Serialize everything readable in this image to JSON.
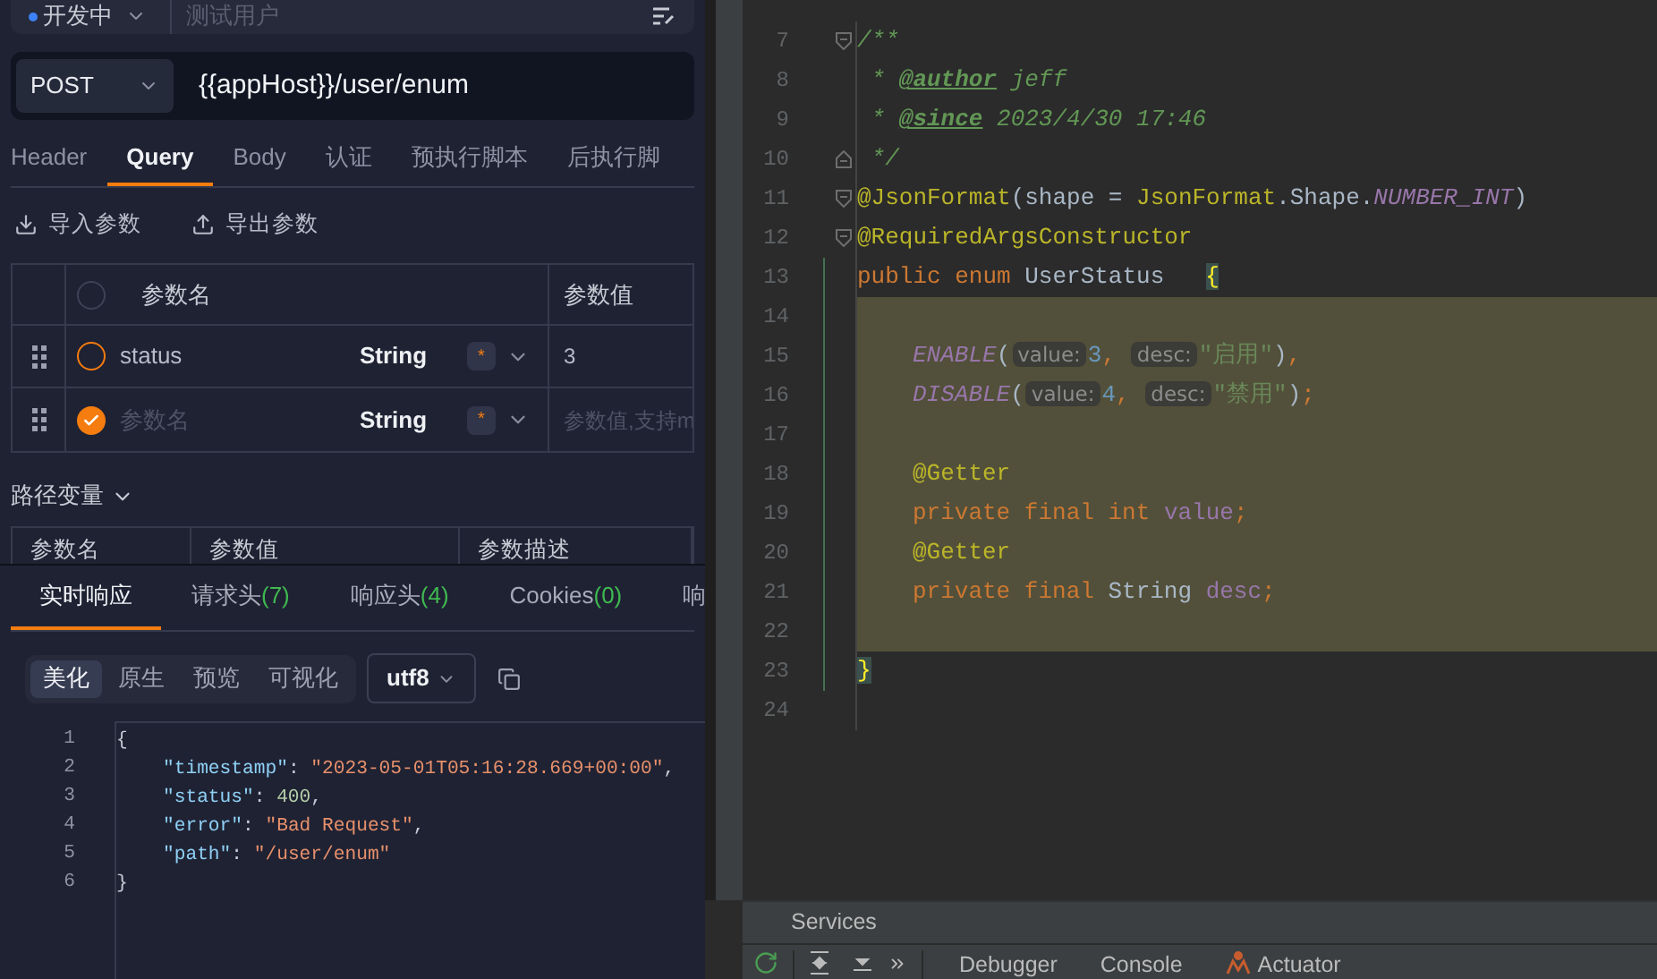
{
  "env_bar": {
    "environment": "开发中",
    "user_placeholder": "测试用户"
  },
  "request": {
    "method": "POST",
    "url": "{{appHost}}/user/enum"
  },
  "request_tabs": [
    {
      "label": "Header",
      "selected": false
    },
    {
      "label": "Query",
      "selected": true
    },
    {
      "label": "Body",
      "selected": false
    },
    {
      "label": "认证",
      "selected": false
    },
    {
      "label": "预执行脚本",
      "selected": false
    },
    {
      "label": "后执行脚",
      "selected": false
    }
  ],
  "param_actions": [
    {
      "kind": "import",
      "label": "导入参数"
    },
    {
      "kind": "export",
      "label": "导出参数"
    }
  ],
  "query_table": {
    "all_checked": false,
    "columns": [
      "参数名",
      "参数值"
    ],
    "rows": [
      {
        "name": "status",
        "type": "String",
        "required_mark": "*",
        "value": "3",
        "checked": false
      },
      {
        "name_placeholder": "参数名",
        "type": "String",
        "required_mark": "*",
        "value_placeholder": "参数值,支持m",
        "checked": true
      }
    ]
  },
  "path_variables": {
    "label": "路径变量",
    "expanded": true,
    "columns": [
      "参数名",
      "参数值",
      "参数描述"
    ]
  },
  "response": {
    "tabs": [
      {
        "label": "实时响应",
        "selected": true
      },
      {
        "label": "请求头",
        "count": "(7)",
        "selected": false
      },
      {
        "label": "响应头",
        "count": "(4)",
        "selected": false
      },
      {
        "label": "Cookies",
        "count": "(0)",
        "selected": false
      },
      {
        "label": "响",
        "selected": false
      }
    ],
    "view_modes": [
      {
        "label": "美化",
        "selected": true
      },
      {
        "label": "原生",
        "selected": false
      },
      {
        "label": "预览",
        "selected": false
      },
      {
        "label": "可视化",
        "selected": false
      }
    ],
    "encoding": "utf8",
    "body_lines": [
      {
        "number": "1",
        "indented": false,
        "tokens": [
          {
            "t": "{",
            "kind": "punct"
          }
        ]
      },
      {
        "number": "2",
        "indented": true,
        "tokens": [
          {
            "t": "\"timestamp\"",
            "kind": "key"
          },
          {
            "t": ": ",
            "kind": "punct"
          },
          {
            "t": "\"2023-05-01T05:16:28.669+00:00\"",
            "kind": "string"
          },
          {
            "t": ",",
            "kind": "punct"
          }
        ]
      },
      {
        "number": "3",
        "indented": true,
        "tokens": [
          {
            "t": "\"status\"",
            "kind": "key"
          },
          {
            "t": ": ",
            "kind": "punct"
          },
          {
            "t": "400",
            "kind": "number"
          },
          {
            "t": ",",
            "kind": "punct"
          }
        ]
      },
      {
        "number": "4",
        "indented": true,
        "tokens": [
          {
            "t": "\"error\"",
            "kind": "key"
          },
          {
            "t": ": ",
            "kind": "punct"
          },
          {
            "t": "\"Bad Request\"",
            "kind": "string"
          },
          {
            "t": ",",
            "kind": "punct"
          }
        ]
      },
      {
        "number": "5",
        "indented": true,
        "tokens": [
          {
            "t": "\"path\"",
            "kind": "key"
          },
          {
            "t": ": ",
            "kind": "punct"
          },
          {
            "t": "\"/user/enum\"",
            "kind": "string"
          }
        ]
      },
      {
        "number": "6",
        "indented": false,
        "tokens": [
          {
            "t": "}",
            "kind": "punct"
          }
        ]
      }
    ]
  },
  "editor": {
    "lines": [
      {
        "number": "7",
        "kind": "fold_open",
        "highlighted": false,
        "indented": false,
        "changed": false,
        "tokens": [
          {
            "t": "/**",
            "kind": "comment"
          }
        ]
      },
      {
        "number": "8",
        "kind": "code",
        "highlighted": false,
        "indented": false,
        "changed": false,
        "tokens": [
          {
            "t": " * ",
            "kind": "comment"
          },
          {
            "t": "@author",
            "kind": "doctag"
          },
          {
            "t": " jeff",
            "kind": "comment"
          }
        ]
      },
      {
        "number": "9",
        "kind": "code",
        "highlighted": false,
        "indented": false,
        "changed": false,
        "tokens": [
          {
            "t": " * ",
            "kind": "comment"
          },
          {
            "t": "@since",
            "kind": "doctag"
          },
          {
            "t": " 2023/4/30 17:46",
            "kind": "comment"
          }
        ]
      },
      {
        "number": "10",
        "kind": "fold_close",
        "highlighted": false,
        "indented": false,
        "changed": false,
        "tokens": [
          {
            "t": " */",
            "kind": "comment"
          }
        ]
      },
      {
        "number": "11",
        "kind": "fold_open",
        "highlighted": false,
        "indented": false,
        "changed": false,
        "tokens": [
          {
            "t": "@JsonFormat",
            "kind": "annotation"
          },
          {
            "t": "(shape = ",
            "kind": "plain"
          },
          {
            "t": "JsonFormat",
            "kind": "annotation"
          },
          {
            "t": ".Shape.",
            "kind": "plain"
          },
          {
            "t": "NUMBER_INT",
            "kind": "constant"
          },
          {
            "t": ")",
            "kind": "plain"
          }
        ]
      },
      {
        "number": "12",
        "kind": "fold_open",
        "highlighted": false,
        "indented": false,
        "changed": false,
        "tokens": [
          {
            "t": "@RequiredArgsConstructor",
            "kind": "annotation"
          }
        ]
      },
      {
        "number": "13",
        "highlighted": false,
        "indented": false,
        "changed": true,
        "tokens": [
          {
            "t": "public enum ",
            "kind": "keyword"
          },
          {
            "t": "UserStatus",
            "kind": "plain"
          },
          {
            "t": "{",
            "kind": "brace"
          }
        ]
      },
      {
        "number": "14",
        "highlighted": true,
        "changed": true
      },
      {
        "number": "15",
        "highlighted": true,
        "indented": true,
        "changed": true,
        "tokens": [
          {
            "t": "ENABLE",
            "kind": "constant"
          },
          {
            "t": "(",
            "kind": "plain"
          },
          {
            "t": "value:",
            "kind": "hint"
          },
          {
            "t": "3",
            "kind": "number"
          },
          {
            "t": ", ",
            "kind": "punct"
          },
          {
            "t": "desc:",
            "kind": "hint"
          },
          {
            "t": "\"启用\"",
            "kind": "string"
          },
          {
            "t": ")",
            "kind": "plain"
          },
          {
            "t": ",",
            "kind": "punct"
          }
        ]
      },
      {
        "number": "16",
        "highlighted": true,
        "indented": true,
        "changed": true,
        "tokens": [
          {
            "t": "DISABLE",
            "kind": "constant"
          },
          {
            "t": "(",
            "kind": "plain"
          },
          {
            "t": "value:",
            "kind": "hint"
          },
          {
            "t": "4",
            "kind": "number"
          },
          {
            "t": ", ",
            "kind": "punct"
          },
          {
            "t": "desc:",
            "kind": "hint"
          },
          {
            "t": "\"禁用\"",
            "kind": "string"
          },
          {
            "t": ")",
            "kind": "plain"
          },
          {
            "t": ";",
            "kind": "punct"
          }
        ]
      },
      {
        "number": "17",
        "highlighted": true,
        "changed": true
      },
      {
        "number": "18",
        "highlighted": true,
        "indented": true,
        "changed": true,
        "tokens": [
          {
            "t": "@Getter",
            "kind": "annotation"
          }
        ]
      },
      {
        "number": "19",
        "highlighted": true,
        "indented": true,
        "changed": true,
        "tokens": [
          {
            "t": "private final int ",
            "kind": "keyword"
          },
          {
            "t": "value",
            "kind": "field"
          },
          {
            "t": ";",
            "kind": "punct"
          }
        ]
      },
      {
        "number": "20",
        "highlighted": true,
        "indented": true,
        "changed": true,
        "tokens": [
          {
            "t": "@Getter",
            "kind": "annotation"
          }
        ]
      },
      {
        "number": "21",
        "highlighted": true,
        "indented": true,
        "changed": true,
        "tokens": [
          {
            "t": "private final ",
            "kind": "keyword"
          },
          {
            "t": "String ",
            "kind": "plain"
          },
          {
            "t": "desc",
            "kind": "field"
          },
          {
            "t": ";",
            "kind": "punct"
          }
        ]
      },
      {
        "number": "22",
        "highlighted": true,
        "changed": true
      },
      {
        "number": "23",
        "highlighted": false,
        "indented": false,
        "changed": true,
        "tokens": [
          {
            "t": "}",
            "kind": "brace"
          }
        ]
      },
      {
        "number": "24",
        "highlighted": false,
        "changed": false
      }
    ]
  },
  "services_panel": {
    "title": "Services",
    "toolbar_tabs": [
      {
        "kind": "plain",
        "label": "Debugger"
      },
      {
        "kind": "plain",
        "label": "Console"
      },
      {
        "kind": "actuator",
        "label": "Actuator"
      }
    ]
  }
}
